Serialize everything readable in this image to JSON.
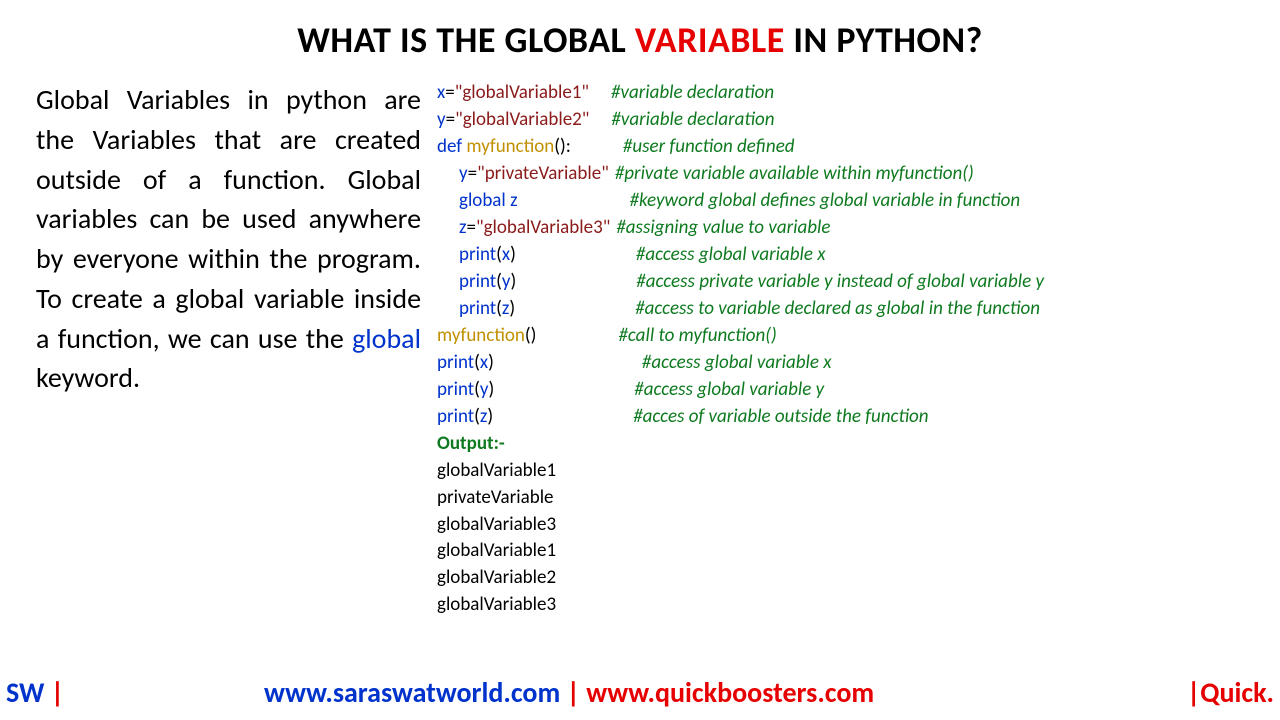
{
  "title": {
    "pre": "WHAT IS THE GLOBAL ",
    "highlight": "VARIABLE",
    "post": " IN PYTHON?"
  },
  "explain": {
    "part1": "Global Variables in python are the Variables that are created outside of a function. Global variables can be used anywhere by everyone within the program. To create a global variable inside a function, we can use the ",
    "keyword": "global",
    "part2": " keyword."
  },
  "code": {
    "lines": [
      {
        "indent": 0,
        "tokens": [
          {
            "t": "x",
            "c": "var"
          },
          {
            "t": "=",
            "c": "plain"
          },
          {
            "t": "\"globalVariable1\"",
            "c": "str"
          }
        ],
        "gap": 22,
        "comment": "#variable declaration"
      },
      {
        "indent": 0,
        "tokens": [
          {
            "t": "y",
            "c": "var"
          },
          {
            "t": "=",
            "c": "plain"
          },
          {
            "t": "\"globalVariable2\"",
            "c": "str"
          }
        ],
        "gap": 22,
        "comment": "#variable declaration"
      },
      {
        "indent": 0,
        "tokens": [
          {
            "t": "def ",
            "c": "kw-def"
          },
          {
            "t": "myfunction",
            "c": "fname"
          },
          {
            "t": "():",
            "c": "plain"
          }
        ],
        "gap": 52,
        "comment": "#user function defined"
      },
      {
        "indent": 1,
        "tokens": [
          {
            "t": "y",
            "c": "var"
          },
          {
            "t": "=",
            "c": "plain"
          },
          {
            "t": "\"privateVariable\"",
            "c": "str"
          }
        ],
        "gap": 6,
        "comment": "#private variable available within myfunction()"
      },
      {
        "indent": 1,
        "tokens": [
          {
            "t": "global ",
            "c": "kw-def"
          },
          {
            "t": "z",
            "c": "var"
          }
        ],
        "gap": 112,
        "comment": "#keyword global defines global variable in function"
      },
      {
        "indent": 1,
        "tokens": [
          {
            "t": "z",
            "c": "var"
          },
          {
            "t": "=",
            "c": "plain"
          },
          {
            "t": "\"globalVariable3\"",
            "c": "str"
          }
        ],
        "gap": 6,
        "comment": "#assigning value to variable"
      },
      {
        "indent": 1,
        "tokens": [
          {
            "t": "print",
            "c": "kw-def"
          },
          {
            "t": "(",
            "c": "plain"
          },
          {
            "t": "x",
            "c": "var"
          },
          {
            "t": ")",
            "c": "plain"
          }
        ],
        "gap": 120,
        "comment": "#access global variable x"
      },
      {
        "indent": 1,
        "tokens": [
          {
            "t": "print",
            "c": "kw-def"
          },
          {
            "t": "(",
            "c": "plain"
          },
          {
            "t": "y",
            "c": "var"
          },
          {
            "t": ")",
            "c": "plain"
          }
        ],
        "gap": 120,
        "comment": "#access private variable y instead of global variable y"
      },
      {
        "indent": 1,
        "tokens": [
          {
            "t": "print",
            "c": "kw-def"
          },
          {
            "t": "(",
            "c": "plain"
          },
          {
            "t": "z",
            "c": "var"
          },
          {
            "t": ")",
            "c": "plain"
          }
        ],
        "gap": 120,
        "comment": "#access to variable declared as global in the function"
      },
      {
        "indent": 0,
        "tokens": [
          {
            "t": "myfunction",
            "c": "fname"
          },
          {
            "t": "()",
            "c": "plain"
          }
        ],
        "gap": 82,
        "comment": "#call to myfunction()"
      },
      {
        "indent": 0,
        "tokens": [
          {
            "t": "print",
            "c": "kw-def"
          },
          {
            "t": "(",
            "c": "plain"
          },
          {
            "t": "x",
            "c": "var"
          },
          {
            "t": ")",
            "c": "plain"
          }
        ],
        "gap": 148,
        "comment": "#access global variable x"
      },
      {
        "indent": 0,
        "tokens": [
          {
            "t": "print",
            "c": "kw-def"
          },
          {
            "t": "(",
            "c": "plain"
          },
          {
            "t": "y",
            "c": "var"
          },
          {
            "t": ")",
            "c": "plain"
          }
        ],
        "gap": 140,
        "comment": "#access global variable y"
      },
      {
        "indent": 0,
        "tokens": [
          {
            "t": "print",
            "c": "kw-def"
          },
          {
            "t": "(",
            "c": "plain"
          },
          {
            "t": "z",
            "c": "var"
          },
          {
            "t": ")",
            "c": "plain"
          }
        ],
        "gap": 140,
        "comment": "#acces of variable outside the function"
      }
    ],
    "output_label": "Output:-",
    "output": [
      "globalVariable1",
      "privateVariable",
      "globalVariable3",
      "globalVariable1",
      "globalVariable2",
      "globalVariable3"
    ]
  },
  "footer": {
    "sw": "SW ",
    "pipe1": "|",
    "url1": "www.saraswatworld.com",
    "sep": " | ",
    "url2": "www.quickboosters.com",
    "quick": "|Quick."
  }
}
